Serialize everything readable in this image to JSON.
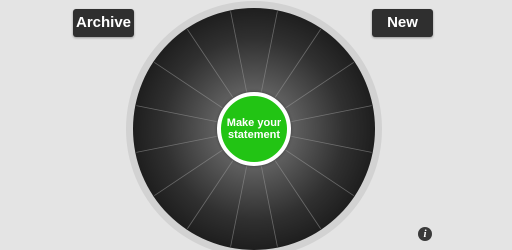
{
  "header": {
    "archive_label": "Archive",
    "new_label": "New"
  },
  "wheel": {
    "center_label": "Make your statement",
    "segment_count": 16
  },
  "footer": {
    "info_icon": "info-icon",
    "info_glyph": "i"
  },
  "colors": {
    "background": "#e4e4e4",
    "button_dark": "#2f2f2f",
    "center_green": "#22c414",
    "wheel_rim": "#d2d2d2"
  }
}
